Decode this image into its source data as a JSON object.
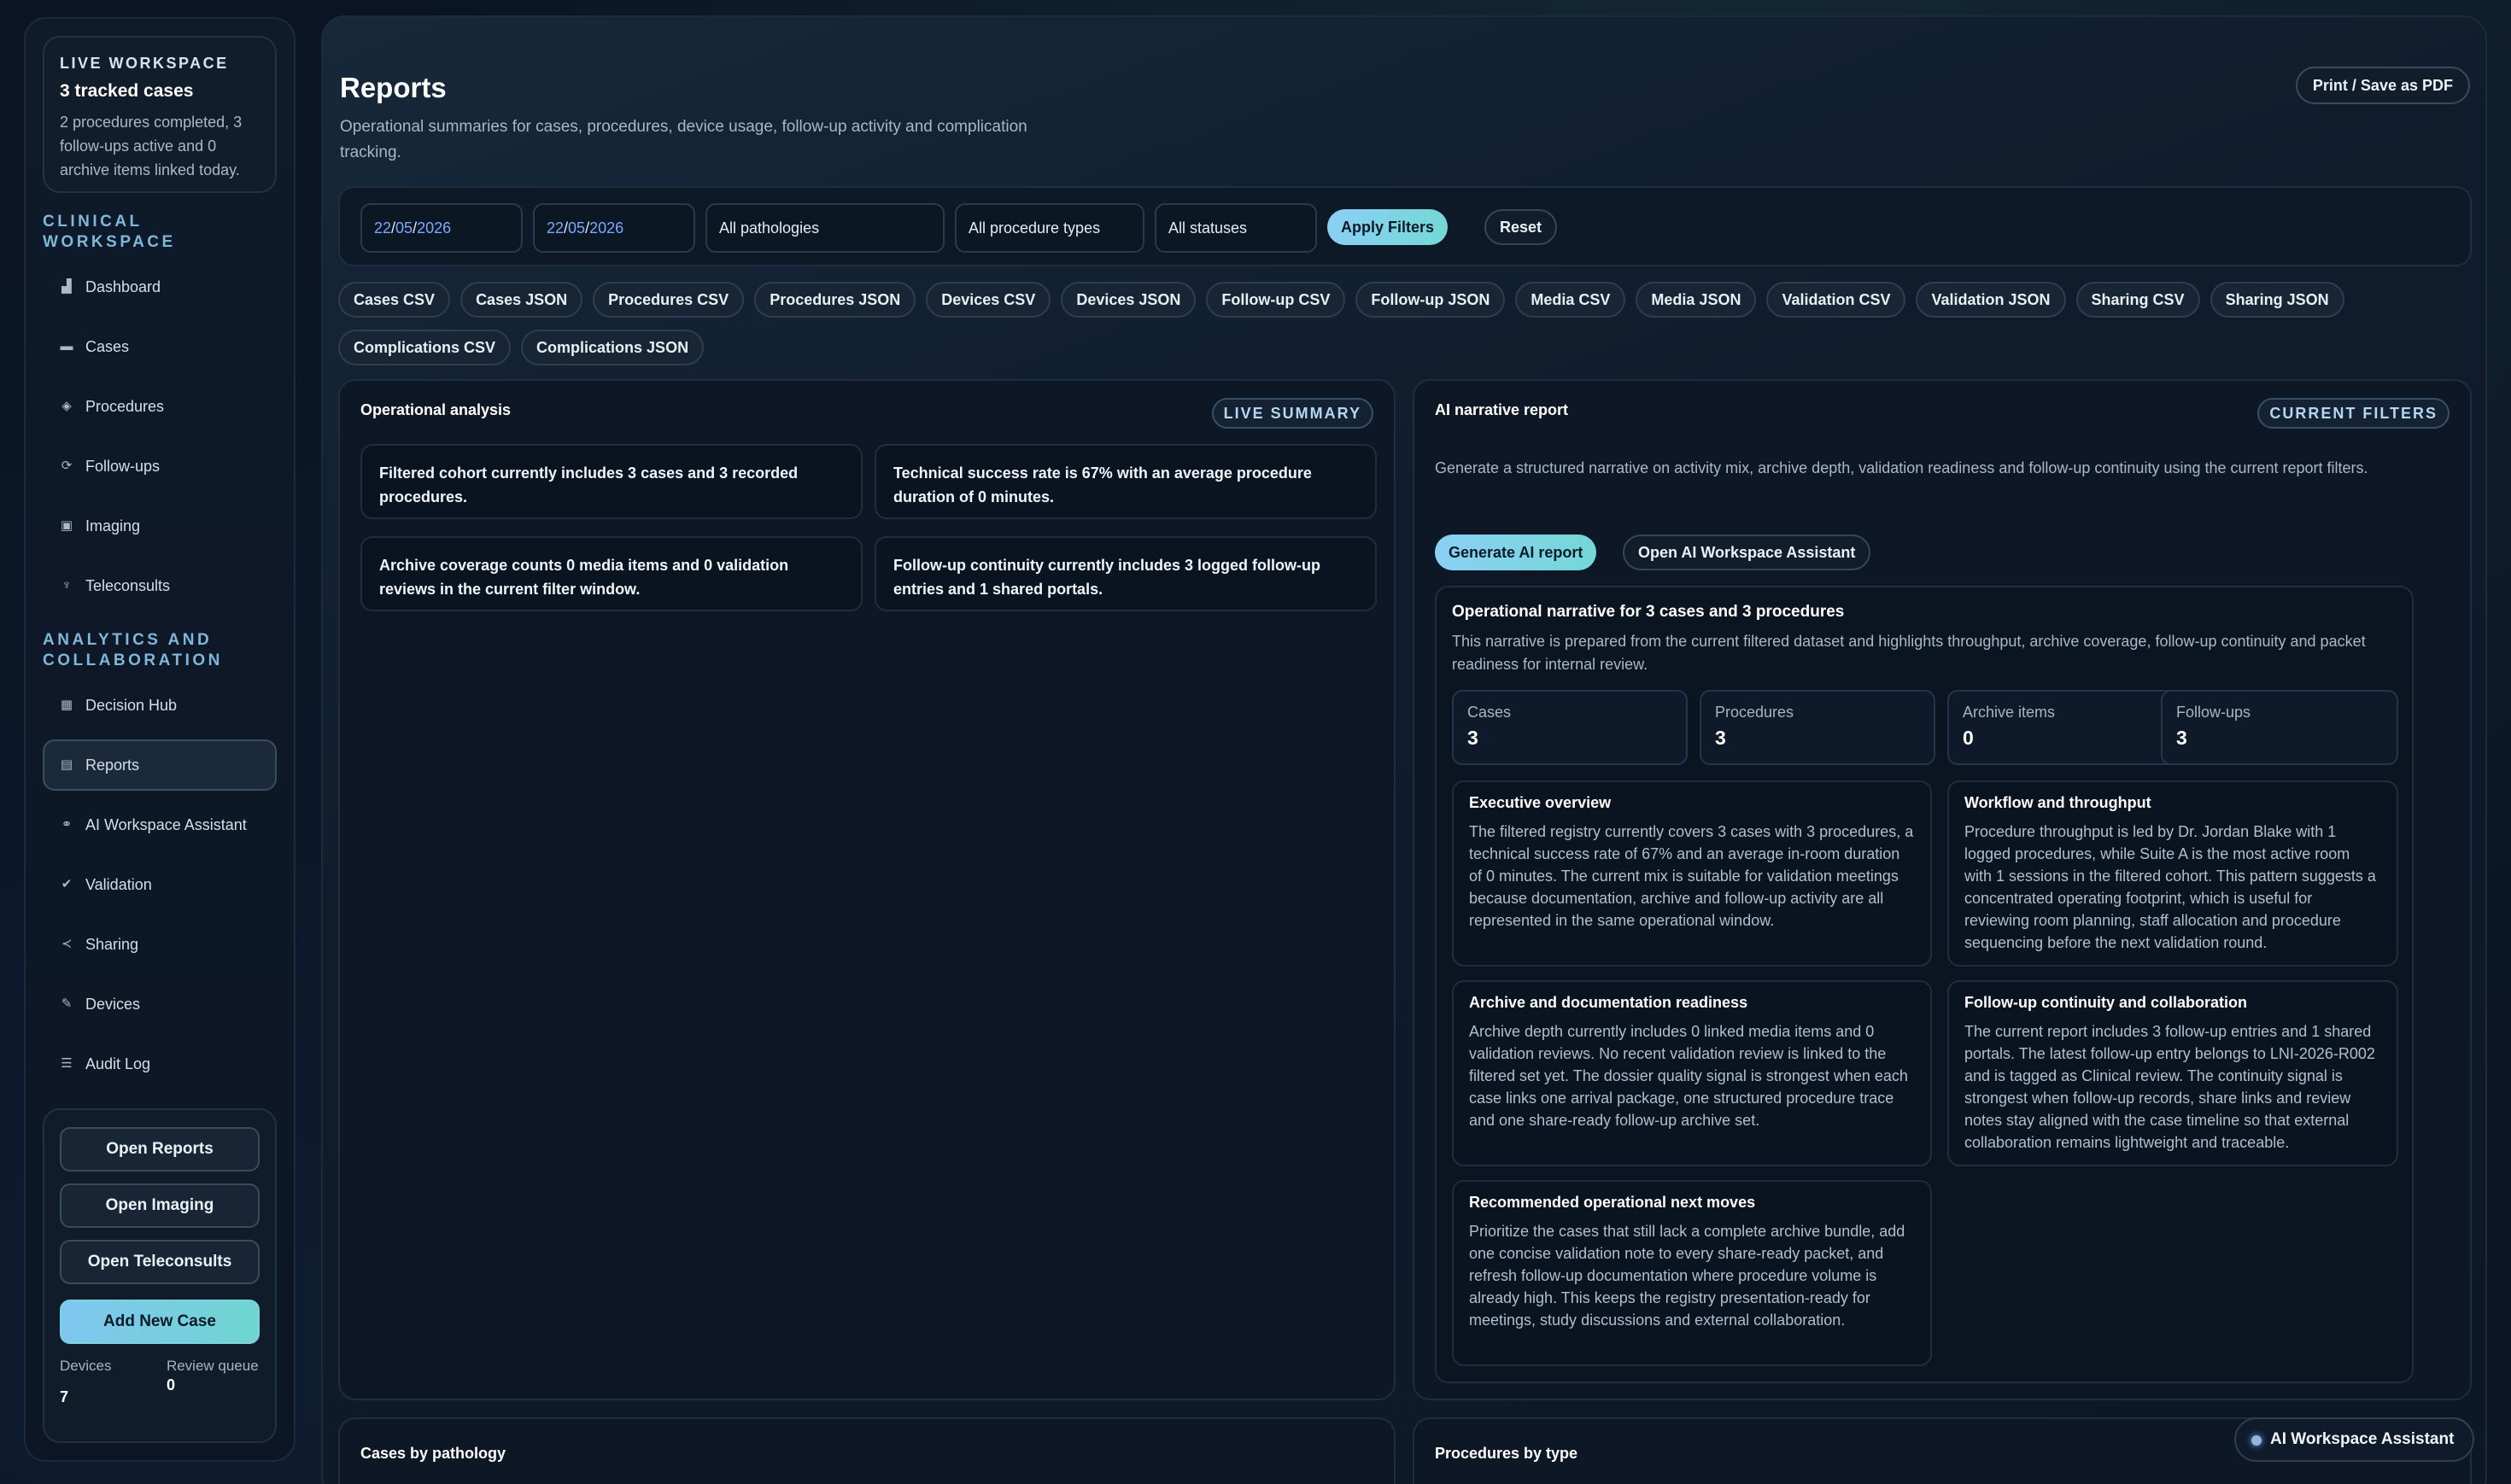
{
  "live": {
    "kicker": "LIVE WORKSPACE",
    "title": "3 tracked cases",
    "desc": "2 procedures completed, 3 follow-ups active and 0 archive items linked today."
  },
  "sidebar": {
    "section1": "CLINICAL WORKSPACE",
    "clinical": [
      {
        "label": "Dashboard",
        "icon": "chart-icon"
      },
      {
        "label": "Cases",
        "icon": "folder-icon"
      },
      {
        "label": "Procedures",
        "icon": "diamond-icon"
      },
      {
        "label": "Follow-ups",
        "icon": "cycle-icon"
      },
      {
        "label": "Imaging",
        "icon": "image-icon"
      },
      {
        "label": "Teleconsults",
        "icon": "microphone-icon"
      }
    ],
    "section2": "ANALYTICS AND COLLABORATION",
    "analytics": [
      {
        "label": "Decision Hub",
        "icon": "grid-icon"
      },
      {
        "label": "Reports",
        "icon": "document-icon"
      },
      {
        "label": "AI Workspace Assistant",
        "icon": "link-icon"
      },
      {
        "label": "Validation",
        "icon": "check-circle-icon"
      },
      {
        "label": "Sharing",
        "icon": "share-icon"
      },
      {
        "label": "Devices",
        "icon": "wrench-icon"
      },
      {
        "label": "Audit Log",
        "icon": "log-icon"
      }
    ],
    "quick": [
      "Open Reports",
      "Open Imaging",
      "Open Teleconsults"
    ],
    "add_case": "Add New Case",
    "stats": [
      {
        "label": "Devices",
        "value": "7"
      },
      {
        "label": "Review queue",
        "value": "0"
      }
    ]
  },
  "header": {
    "title": "Reports",
    "subtitle": "Operational summaries for cases, procedures, device usage, follow-up activity and complication tracking.",
    "print": "Print / Save as PDF"
  },
  "filters": {
    "date_from": {
      "dd": "22",
      "mm": "05",
      "yyyy": "2026"
    },
    "date_to": {
      "dd": "22",
      "mm": "05",
      "yyyy": "2026"
    },
    "pathology": "All pathologies",
    "procedure_type": "All procedure types",
    "status": "All statuses",
    "apply": "Apply Filters",
    "reset": "Reset"
  },
  "exports": [
    "Cases CSV",
    "Cases JSON",
    "Procedures CSV",
    "Procedures JSON",
    "Devices CSV",
    "Devices JSON",
    "Follow-up CSV",
    "Follow-up JSON",
    "Media CSV",
    "Media JSON",
    "Validation CSV",
    "Validation JSON",
    "Sharing CSV",
    "Sharing JSON",
    "Complications CSV",
    "Complications JSON"
  ],
  "analysis": {
    "title": "Operational analysis",
    "badge": "LIVE SUMMARY",
    "insights": [
      "Filtered cohort currently includes 3 cases and 3 recorded procedures.",
      "Technical success rate is 67% with an average procedure duration of 0 minutes.",
      "Archive coverage counts 0 media items and 0 validation reviews in the current filter window.",
      "Follow-up continuity currently includes 3 logged follow-up entries and 1 shared portals."
    ]
  },
  "ai": {
    "title": "AI narrative report",
    "badge": "CURRENT FILTERS",
    "desc": "Generate a structured narrative on activity mix, archive depth, validation readiness and follow-up continuity using the current report filters.",
    "generate": "Generate AI report",
    "open": "Open AI Workspace Assistant",
    "narrative": {
      "title": "Operational narrative for 3 cases and 3 procedures",
      "desc": "This narrative is prepared from the current filtered dataset and highlights throughput, archive coverage, follow-up continuity and packet readiness for internal review.",
      "kpis": [
        {
          "label": "Cases",
          "value": "3"
        },
        {
          "label": "Procedures",
          "value": "3"
        },
        {
          "label": "Archive items",
          "value": "0"
        },
        {
          "label": "Follow-ups",
          "value": "3"
        }
      ],
      "sections": [
        {
          "title": "Executive overview",
          "body": "The filtered registry currently covers 3 cases with 3 procedures, a technical success rate of 67% and an average in-room duration of 0 minutes. The current mix is suitable for validation meetings because documentation, archive and follow-up activity are all represented in the same operational window."
        },
        {
          "title": "Workflow and throughput",
          "body": "Procedure throughput is led by Dr. Jordan Blake with 1 logged procedures, while Suite A is the most active room with 1 sessions in the filtered cohort. This pattern suggests a concentrated operating footprint, which is useful for reviewing room planning, staff allocation and procedure sequencing before the next validation round."
        },
        {
          "title": "Archive and documentation readiness",
          "body": "Archive depth currently includes 0 linked media items and 0 validation reviews. No recent validation review is linked to the filtered set yet. The dossier quality signal is strongest when each case links one arrival package, one structured procedure trace and one share-ready follow-up archive set."
        },
        {
          "title": "Follow-up continuity and collaboration",
          "body": "The current report includes 3 follow-up entries and 1 shared portals. The latest follow-up entry belongs to LNI-2026-R002 and is tagged as Clinical review. The continuity signal is strongest when follow-up records, share links and review notes stay aligned with the case timeline so that external collaboration remains lightweight and traceable."
        },
        {
          "title": "Recommended operational next moves",
          "body": "Prioritize the cases that still lack a complete archive bundle, add one concise validation note to every share-ready packet, and refresh follow-up documentation where procedure volume is already high. This keeps the registry presentation-ready for meetings, study discussions and external collaboration."
        }
      ]
    }
  },
  "bottom": {
    "left_title": "Cases by pathology",
    "right_title": "Procedures by type"
  },
  "floating": {
    "label": "AI Workspace Assistant"
  }
}
